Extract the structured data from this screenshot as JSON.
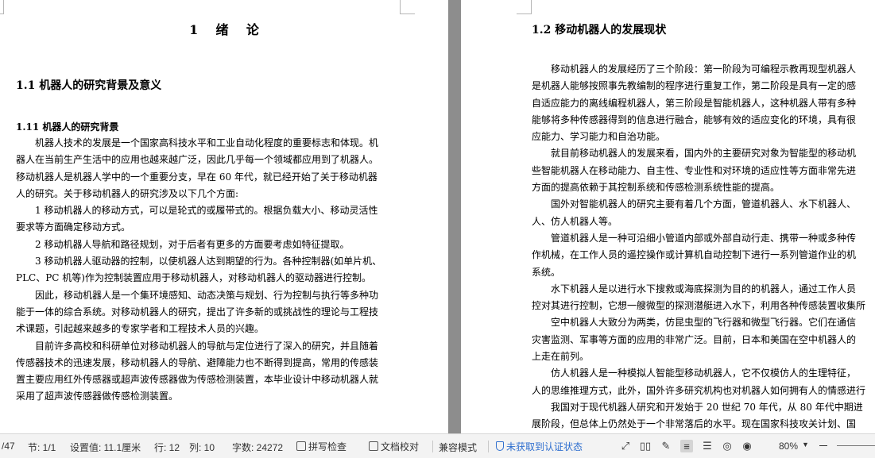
{
  "left_page": {
    "chapter_title": "1    绪    论",
    "section_title": "1.1  机器人的研究背景及意义",
    "subsection_title": "1.11  机器人的研究背景",
    "paragraphs": [
      {
        "indent": true,
        "lines": [
          "机器人技术的发展是一个国家高科技水平和工业自动化程度的重要标志和体现。机",
          "器人在当前生产生活中的应用也越来越广泛，因此几乎每一个领域都应用到了机器人。",
          "移动机器人是机器人学中的一个重要分支，早在 60 年代，就已经开始了关于移动机器",
          "人的研究。关于移动机器人的研究涉及以下几个方面:"
        ]
      },
      {
        "indent": true,
        "lines": [
          "1 移动机器人的移动方式，可以是轮式的或履带式的。根据负载大小、移动灵活性",
          "要求等方面确定移动方式。"
        ]
      },
      {
        "indent": true,
        "lines": [
          "2  移动机器人导航和路径规划，对于后者有更多的方面要考虑如特征提取。"
        ]
      },
      {
        "indent": true,
        "lines": [
          "3  移动机器人驱动器的控制，以使机器人达到期望的行为。各种控制器(如单片机、",
          "PLC、PC 机等)作为控制装置应用于移动机器人，对移动机器人的驱动器进行控制。"
        ]
      },
      {
        "indent": true,
        "lines": [
          "因此，移动机器人是一个集环境感知、动态决策与规划、行为控制与执行等多种功",
          "能于一体的综合系统。对移动机器人的研究，提出了许多新的或挑战性的理论与工程技",
          "术课题，引起越来越多的专家学者和工程技术人员的兴趣。"
        ]
      },
      {
        "indent": true,
        "lines": [
          "目前许多高校和科研单位对移动机器人的导航与定位进行了深入的研究，并且随着",
          "传感器技术的迅速发展，移动机器人的导航、避障能力也不断得到提高，常用的传感装",
          "置主要应用红外传感器或超声波传感器做为传感检测装置，本毕业设计中移动机器人就",
          "采用了超声波传感器做传感检测装置。"
        ]
      }
    ]
  },
  "right_page": {
    "section_title": "1.2 移动机器人的发展现状",
    "paragraphs": [
      {
        "indent": true,
        "lines": [
          "移动机器人的发展经历了三个阶段：第一阶段为可编程示教再现型机器人",
          "是机器人能够按照事先教编制的程序进行重复工作，第二阶段是具有一定的感",
          "自适应能力的离线编程机器人，第三阶段是智能机器人，这种机器人带有多种",
          "能够将多种传感器得到的信息进行融合，能够有效的适应变化的环境，具有很",
          "应能力、学习能力和自治功能。"
        ]
      },
      {
        "indent": true,
        "lines": [
          "就目前移动机器人的发展来看，国内外的主要研究对象为智能型的移动机",
          "些智能机器人在移动能力、自主性、专业性和对环境的适应性等方面非常先进",
          "方面的提高依赖于其控制系统和传感检测系统性能的提高。"
        ]
      },
      {
        "indent": true,
        "lines": [
          "国外对智能机器人的研究主要有着几个方面，管道机器人、水下机器人、",
          "人、仿人机器人等。"
        ]
      },
      {
        "indent": true,
        "lines": [
          "管道机器人是一种可沿细小管道内部或外部自动行走、携带一种或多种传",
          "作机械，在工作人员的遥控操作或计算机自动控制下进行一系列管道作业的机",
          "系统。"
        ]
      },
      {
        "indent": true,
        "lines": [
          "水下机器人是以进行水下搜救或海底探测为目的的机器人，通过工作人员",
          "控对其进行控制，它想一艘微型的探测潜艇进入水下，利用各种传感装置收集所"
        ]
      },
      {
        "indent": true,
        "lines": [
          "空中机器人大致分为两类，仿昆虫型的飞行器和微型飞行器。它们在通信",
          "灾害监测、军事等方面的应用的非常广泛。目前，日本和美国在空中机器人的",
          "上走在前列。"
        ]
      },
      {
        "indent": true,
        "lines": [
          "仿人机器人是一种模拟人智能型移动机器人，它不仅模仿人的生理特征，",
          "人的思维推理方式，此外，国外许多研究机构也对机器人如何拥有人的情感进行"
        ]
      },
      {
        "indent": true,
        "lines": [
          "我国对于现代机器人研究和开发始于 20 世纪 70 年代，从 80 年代中期进",
          "展阶段，但总体上仍然处于一个非常落后的水平。现在国家科技攻关计划、国"
        ]
      }
    ]
  },
  "status_bar": {
    "page": "/47",
    "section": "节: 1/1",
    "setting": "设置值: 11.1厘米",
    "row": "行: 12",
    "col": "列: 10",
    "wordcount": "字数: 24272",
    "spellcheck": "拼写检查",
    "doc_proof": "文档校对",
    "compat_mode": "兼容模式",
    "auth_status": "未获取到认证状态",
    "zoom": "80%",
    "icons": [
      "fullscreen-icon",
      "read-mode-icon",
      "edit-pen-icon",
      "page-view-icon",
      "outline-view-icon",
      "web-view-icon",
      "eye-protect-icon"
    ]
  }
}
